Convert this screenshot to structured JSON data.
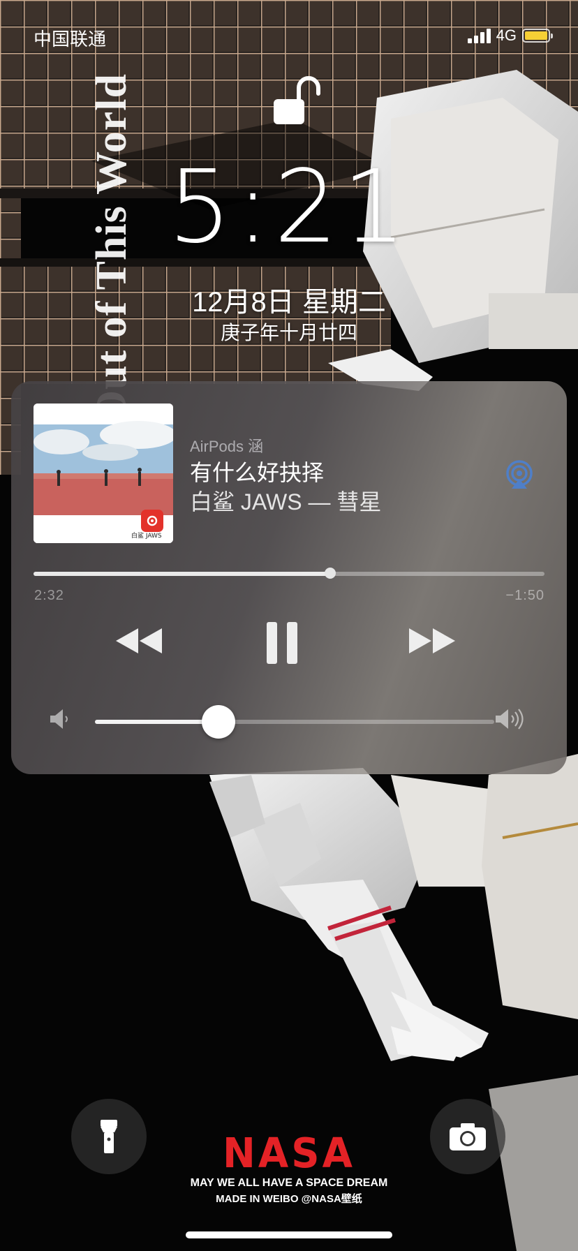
{
  "status_bar": {
    "carrier": "中国联通",
    "network": "4G",
    "signal_bars": 4,
    "battery_color": "#f6cf35"
  },
  "lock_screen": {
    "lock_state": "unlocked",
    "time": "5:21",
    "date": "12月8日 星期二",
    "lunar_date": "庚子年十月廿四"
  },
  "wallpaper": {
    "vertical_text": "Out of This World",
    "brand": "NASA",
    "line1": "MAY WE ALL HAVE A SPACE DREAM",
    "line2": "MADE IN WEIBO @NASA壁纸"
  },
  "now_playing": {
    "output_device": "AirPods 涵",
    "title": "有什么好抉择",
    "artist_album": "白鲨 JAWS — 彗星",
    "elapsed": "2:32",
    "remaining": "−1:50",
    "progress_fraction": 0.58,
    "volume_fraction": 0.31,
    "artwork_caption": "白鲨 JAWS",
    "airplay_color": "#4f7fc8",
    "artwork_badge_color": "#e3322b"
  },
  "bottom": {
    "left_button_icon": "flashlight-icon",
    "right_button_icon": "camera-icon"
  }
}
